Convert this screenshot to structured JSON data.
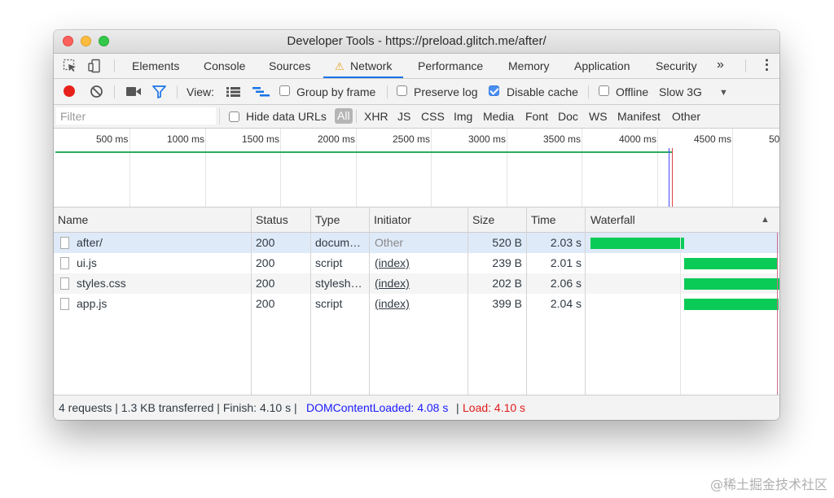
{
  "window": {
    "title": "Developer Tools - https://preload.glitch.me/after/"
  },
  "tabs": {
    "items": [
      "Elements",
      "Console",
      "Sources",
      "Network",
      "Performance",
      "Memory",
      "Application",
      "Security"
    ],
    "active": "Network",
    "overflow": "»",
    "more": "⋮",
    "warning_icon": "⚠"
  },
  "toolbar": {
    "view_label": "View:",
    "group_by_frame": "Group by frame",
    "preserve_log": "Preserve log",
    "disable_cache": "Disable cache",
    "disable_cache_checked": true,
    "offline": "Offline",
    "throttle": "Slow 3G",
    "throttle_arrow": "▼"
  },
  "filter": {
    "placeholder": "Filter",
    "hide_data_urls": "Hide data URLs",
    "types": [
      "All",
      "XHR",
      "JS",
      "CSS",
      "Img",
      "Media",
      "Font",
      "Doc",
      "WS",
      "Manifest",
      "Other"
    ],
    "active_type": "All"
  },
  "overview": {
    "ticks": [
      "500 ms",
      "1000 ms",
      "1500 ms",
      "2000 ms",
      "2500 ms",
      "3000 ms",
      "3500 ms",
      "4000 ms",
      "4500 ms",
      "50"
    ]
  },
  "grid": {
    "columns": [
      "Name",
      "Status",
      "Type",
      "Initiator",
      "Size",
      "Time",
      "Waterfall"
    ],
    "sort_arrow": "▲",
    "rows": [
      {
        "name": "after/",
        "status": "200",
        "type": "docum…",
        "initiator": "Other",
        "size": "520 B",
        "time": "2.03 s"
      },
      {
        "name": "ui.js",
        "status": "200",
        "type": "script",
        "initiator": "(index)",
        "size": "239 B",
        "time": "2.01 s"
      },
      {
        "name": "styles.css",
        "status": "200",
        "type": "stylesh…",
        "initiator": "(index)",
        "size": "202 B",
        "time": "2.06 s"
      },
      {
        "name": "app.js",
        "status": "200",
        "type": "script",
        "initiator": "(index)",
        "size": "399 B",
        "time": "2.04 s"
      }
    ]
  },
  "status": {
    "summary": "4 requests | 1.3 KB transferred | Finish: 4.10 s |",
    "dom_content_loaded": "DOMContentLoaded: 4.08 s",
    "sep": "|",
    "load": "Load: 4.10 s",
    "colors": {
      "dcl": "#1a1aff",
      "load": "#e01b1b",
      "waterfall": "#0bcb57"
    }
  },
  "watermark": "@稀土掘金技术社区"
}
